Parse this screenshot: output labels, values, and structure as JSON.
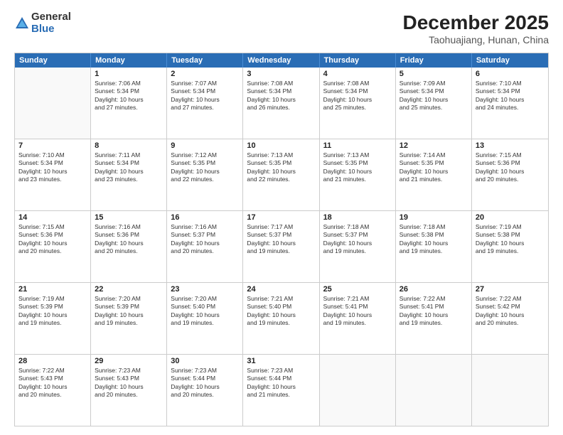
{
  "logo": {
    "general": "General",
    "blue": "Blue"
  },
  "title": "December 2025",
  "location": "Taohuajiang, Hunan, China",
  "days_of_week": [
    "Sunday",
    "Monday",
    "Tuesday",
    "Wednesday",
    "Thursday",
    "Friday",
    "Saturday"
  ],
  "weeks": [
    [
      {
        "day": "",
        "info": ""
      },
      {
        "day": "1",
        "info": "Sunrise: 7:06 AM\nSunset: 5:34 PM\nDaylight: 10 hours\nand 27 minutes."
      },
      {
        "day": "2",
        "info": "Sunrise: 7:07 AM\nSunset: 5:34 PM\nDaylight: 10 hours\nand 27 minutes."
      },
      {
        "day": "3",
        "info": "Sunrise: 7:08 AM\nSunset: 5:34 PM\nDaylight: 10 hours\nand 26 minutes."
      },
      {
        "day": "4",
        "info": "Sunrise: 7:08 AM\nSunset: 5:34 PM\nDaylight: 10 hours\nand 25 minutes."
      },
      {
        "day": "5",
        "info": "Sunrise: 7:09 AM\nSunset: 5:34 PM\nDaylight: 10 hours\nand 25 minutes."
      },
      {
        "day": "6",
        "info": "Sunrise: 7:10 AM\nSunset: 5:34 PM\nDaylight: 10 hours\nand 24 minutes."
      }
    ],
    [
      {
        "day": "7",
        "info": "Sunrise: 7:10 AM\nSunset: 5:34 PM\nDaylight: 10 hours\nand 23 minutes."
      },
      {
        "day": "8",
        "info": "Sunrise: 7:11 AM\nSunset: 5:34 PM\nDaylight: 10 hours\nand 23 minutes."
      },
      {
        "day": "9",
        "info": "Sunrise: 7:12 AM\nSunset: 5:35 PM\nDaylight: 10 hours\nand 22 minutes."
      },
      {
        "day": "10",
        "info": "Sunrise: 7:13 AM\nSunset: 5:35 PM\nDaylight: 10 hours\nand 22 minutes."
      },
      {
        "day": "11",
        "info": "Sunrise: 7:13 AM\nSunset: 5:35 PM\nDaylight: 10 hours\nand 21 minutes."
      },
      {
        "day": "12",
        "info": "Sunrise: 7:14 AM\nSunset: 5:35 PM\nDaylight: 10 hours\nand 21 minutes."
      },
      {
        "day": "13",
        "info": "Sunrise: 7:15 AM\nSunset: 5:36 PM\nDaylight: 10 hours\nand 20 minutes."
      }
    ],
    [
      {
        "day": "14",
        "info": "Sunrise: 7:15 AM\nSunset: 5:36 PM\nDaylight: 10 hours\nand 20 minutes."
      },
      {
        "day": "15",
        "info": "Sunrise: 7:16 AM\nSunset: 5:36 PM\nDaylight: 10 hours\nand 20 minutes."
      },
      {
        "day": "16",
        "info": "Sunrise: 7:16 AM\nSunset: 5:37 PM\nDaylight: 10 hours\nand 20 minutes."
      },
      {
        "day": "17",
        "info": "Sunrise: 7:17 AM\nSunset: 5:37 PM\nDaylight: 10 hours\nand 19 minutes."
      },
      {
        "day": "18",
        "info": "Sunrise: 7:18 AM\nSunset: 5:37 PM\nDaylight: 10 hours\nand 19 minutes."
      },
      {
        "day": "19",
        "info": "Sunrise: 7:18 AM\nSunset: 5:38 PM\nDaylight: 10 hours\nand 19 minutes."
      },
      {
        "day": "20",
        "info": "Sunrise: 7:19 AM\nSunset: 5:38 PM\nDaylight: 10 hours\nand 19 minutes."
      }
    ],
    [
      {
        "day": "21",
        "info": "Sunrise: 7:19 AM\nSunset: 5:39 PM\nDaylight: 10 hours\nand 19 minutes."
      },
      {
        "day": "22",
        "info": "Sunrise: 7:20 AM\nSunset: 5:39 PM\nDaylight: 10 hours\nand 19 minutes."
      },
      {
        "day": "23",
        "info": "Sunrise: 7:20 AM\nSunset: 5:40 PM\nDaylight: 10 hours\nand 19 minutes."
      },
      {
        "day": "24",
        "info": "Sunrise: 7:21 AM\nSunset: 5:40 PM\nDaylight: 10 hours\nand 19 minutes."
      },
      {
        "day": "25",
        "info": "Sunrise: 7:21 AM\nSunset: 5:41 PM\nDaylight: 10 hours\nand 19 minutes."
      },
      {
        "day": "26",
        "info": "Sunrise: 7:22 AM\nSunset: 5:41 PM\nDaylight: 10 hours\nand 19 minutes."
      },
      {
        "day": "27",
        "info": "Sunrise: 7:22 AM\nSunset: 5:42 PM\nDaylight: 10 hours\nand 20 minutes."
      }
    ],
    [
      {
        "day": "28",
        "info": "Sunrise: 7:22 AM\nSunset: 5:43 PM\nDaylight: 10 hours\nand 20 minutes."
      },
      {
        "day": "29",
        "info": "Sunrise: 7:23 AM\nSunset: 5:43 PM\nDaylight: 10 hours\nand 20 minutes."
      },
      {
        "day": "30",
        "info": "Sunrise: 7:23 AM\nSunset: 5:44 PM\nDaylight: 10 hours\nand 20 minutes."
      },
      {
        "day": "31",
        "info": "Sunrise: 7:23 AM\nSunset: 5:44 PM\nDaylight: 10 hours\nand 21 minutes."
      },
      {
        "day": "",
        "info": ""
      },
      {
        "day": "",
        "info": ""
      },
      {
        "day": "",
        "info": ""
      }
    ]
  ]
}
